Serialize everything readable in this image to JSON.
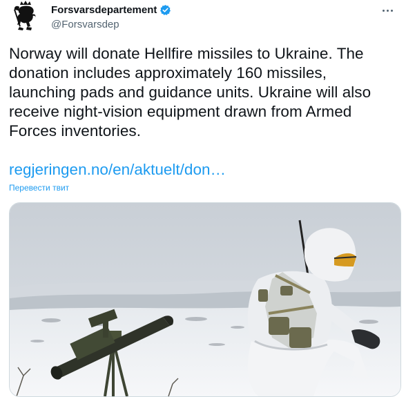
{
  "author": {
    "display_name": "Forsvarsdepartement",
    "handle": "@Forsvarsdep",
    "verified": true,
    "avatar_icon": "norwegian-lion-coat-of-arms-icon"
  },
  "tweet": {
    "text": "Norway will donate Hellfire missiles to Ukraine. The donation includes approximately 160 missiles, launching pads and guidance units. Ukraine will also receive night-vision equipment drawn from Armed Forces inventories.",
    "link_text": "regjeringen.no/en/aktuelt/don…",
    "translate_label": "Перевести твит"
  },
  "media": {
    "type": "photo",
    "subject": "soldier-in-winter-camouflage-with-missile-launcher"
  },
  "colors": {
    "accent": "#1d9bf0",
    "text": "#0f1419",
    "secondary": "#536471"
  }
}
